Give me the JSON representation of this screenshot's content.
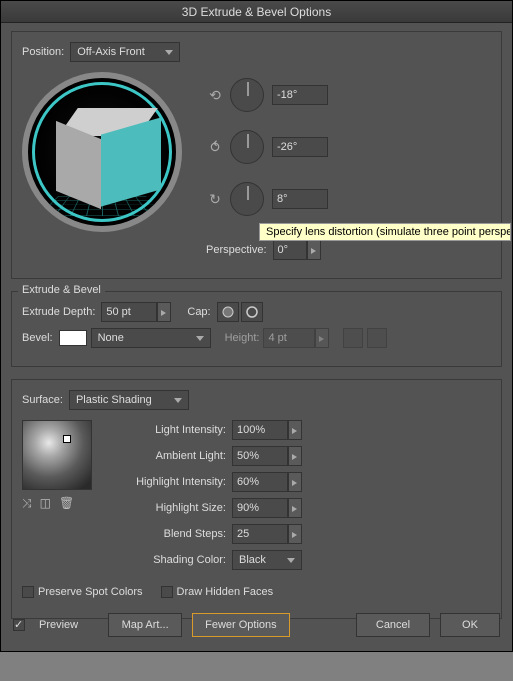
{
  "title": "3D Extrude & Bevel Options",
  "position": {
    "label": "Position:",
    "value": "Off-Axis Front"
  },
  "rotation": {
    "x": "-18°",
    "y": "-26°",
    "z": "8°"
  },
  "perspective": {
    "label": "Perspective:",
    "value": "0°",
    "tooltip": "Specify lens distortion (simulate three point perspec"
  },
  "extrude_bevel": {
    "title": "Extrude & Bevel",
    "depth_label": "Extrude Depth:",
    "depth": "50 pt",
    "cap_label": "Cap:",
    "bevel_label": "Bevel:",
    "bevel_value": "None",
    "height_label": "Height:",
    "height_value": "4 pt"
  },
  "surface": {
    "label": "Surface:",
    "value": "Plastic Shading",
    "light_intensity_label": "Light Intensity:",
    "light_intensity": "100%",
    "ambient_label": "Ambient Light:",
    "ambient": "50%",
    "highlight_intensity_label": "Highlight Intensity:",
    "highlight_intensity": "60%",
    "highlight_size_label": "Highlight Size:",
    "highlight_size": "90%",
    "blend_steps_label": "Blend Steps:",
    "blend_steps": "25",
    "shading_color_label": "Shading Color:",
    "shading_color": "Black",
    "preserve_spot": "Preserve Spot Colors",
    "draw_hidden": "Draw Hidden Faces"
  },
  "footer": {
    "preview": "Preview",
    "map_art": "Map Art...",
    "fewer": "Fewer Options",
    "cancel": "Cancel",
    "ok": "OK"
  }
}
